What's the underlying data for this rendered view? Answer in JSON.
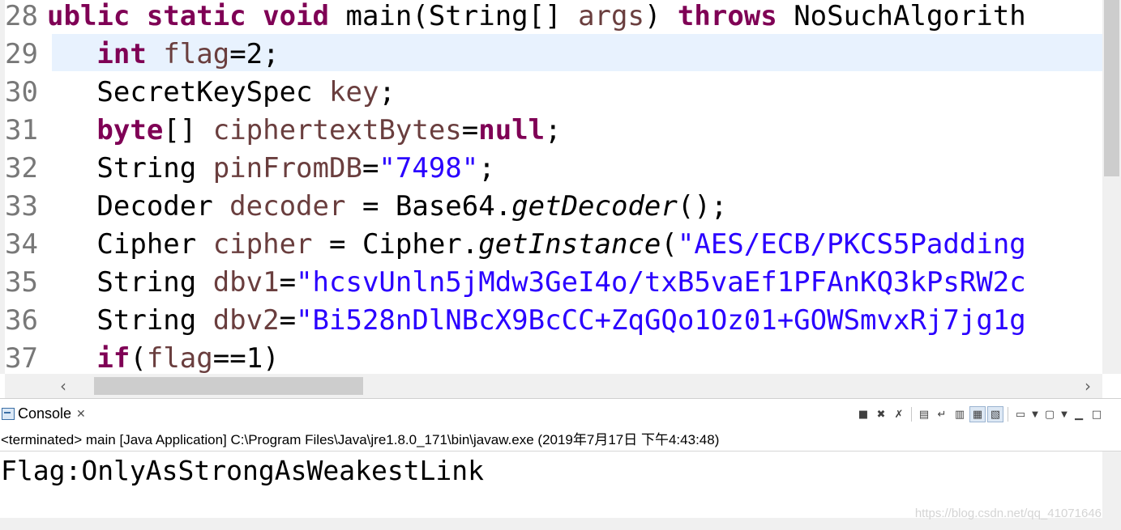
{
  "editor": {
    "lines": [
      {
        "num": "28",
        "tokens": [
          {
            "t": "ublic ",
            "c": "kw"
          },
          {
            "t": "static ",
            "c": "kw"
          },
          {
            "t": "void ",
            "c": "kw"
          },
          {
            "t": "main(String[] ",
            "c": ""
          },
          {
            "t": "args",
            "c": "var"
          },
          {
            "t": ") ",
            "c": ""
          },
          {
            "t": "throws ",
            "c": "kw"
          },
          {
            "t": "NoSuchAlgorith",
            "c": ""
          }
        ]
      },
      {
        "num": "29",
        "tokens": [
          {
            "t": "   ",
            "c": ""
          },
          {
            "t": "int ",
            "c": "kw"
          },
          {
            "t": "flag",
            "c": "var"
          },
          {
            "t": "=2;",
            "c": ""
          }
        ]
      },
      {
        "num": "30",
        "tokens": [
          {
            "t": "   SecretKeySpec ",
            "c": ""
          },
          {
            "t": "key",
            "c": "var"
          },
          {
            "t": ";",
            "c": ""
          }
        ]
      },
      {
        "num": "31",
        "tokens": [
          {
            "t": "   ",
            "c": ""
          },
          {
            "t": "byte",
            "c": "kw"
          },
          {
            "t": "[] ",
            "c": ""
          },
          {
            "t": "ciphertextBytes",
            "c": "var"
          },
          {
            "t": "=",
            "c": ""
          },
          {
            "t": "null",
            "c": "kw"
          },
          {
            "t": ";",
            "c": ""
          }
        ]
      },
      {
        "num": "32",
        "tokens": [
          {
            "t": "   String ",
            "c": ""
          },
          {
            "t": "pinFromDB",
            "c": "var"
          },
          {
            "t": "=",
            "c": ""
          },
          {
            "t": "\"7498\"",
            "c": "str"
          },
          {
            "t": ";",
            "c": ""
          }
        ]
      },
      {
        "num": "33",
        "tokens": [
          {
            "t": "   Decoder ",
            "c": ""
          },
          {
            "t": "decoder",
            "c": "var"
          },
          {
            "t": " = Base64.",
            "c": ""
          },
          {
            "t": "getDecoder",
            "c": "mth"
          },
          {
            "t": "();",
            "c": ""
          }
        ]
      },
      {
        "num": "34",
        "tokens": [
          {
            "t": "   Cipher ",
            "c": ""
          },
          {
            "t": "cipher",
            "c": "var"
          },
          {
            "t": " = Cipher.",
            "c": ""
          },
          {
            "t": "getInstance",
            "c": "mth"
          },
          {
            "t": "(",
            "c": ""
          },
          {
            "t": "\"AES/ECB/PKCS5Padding",
            "c": "str"
          }
        ]
      },
      {
        "num": "35",
        "tokens": [
          {
            "t": "   String ",
            "c": ""
          },
          {
            "t": "dbv1",
            "c": "var"
          },
          {
            "t": "=",
            "c": ""
          },
          {
            "t": "\"hcsvUnln5jMdw3GeI4o/txB5vaEf1PFAnKQ3kPsRW2c",
            "c": "str"
          }
        ]
      },
      {
        "num": "36",
        "tokens": [
          {
            "t": "   String ",
            "c": ""
          },
          {
            "t": "dbv2",
            "c": "var"
          },
          {
            "t": "=",
            "c": ""
          },
          {
            "t": "\"Bi528nDlNBcX9BcCC+ZqGQo1Oz01+GOWSmvxRj7jg1g",
            "c": "str"
          }
        ]
      },
      {
        "num": "37",
        "tokens": [
          {
            "t": "   ",
            "c": ""
          },
          {
            "t": "if",
            "c": "kw"
          },
          {
            "t": "(",
            "c": ""
          },
          {
            "t": "flag",
            "c": "var"
          },
          {
            "t": "==1)",
            "c": ""
          }
        ]
      }
    ],
    "scroll_left_arrow": "‹",
    "scroll_right_arrow": "›"
  },
  "console": {
    "tab_label": "Console",
    "tab_close": "✕",
    "header": "<terminated> main [Java Application] C:\\Program Files\\Java\\jre1.8.0_171\\bin\\javaw.exe (2019年7月17日 下午4:43:48)",
    "output": "Flag:OnlyAsStrongAsWeakestLink",
    "toolbar_icons": [
      "terminate-icon",
      "remove-launch-icon",
      "remove-all-terminated-icon",
      "scroll-lock-icon",
      "word-wrap-icon",
      "show-stdout-icon",
      "show-stderr-icon",
      "pin-console-icon",
      "display-console-icon",
      "new-console-icon",
      "minimize-icon",
      "maximize-icon"
    ]
  },
  "watermark": "https://blog.csdn.net/qq_41071646"
}
